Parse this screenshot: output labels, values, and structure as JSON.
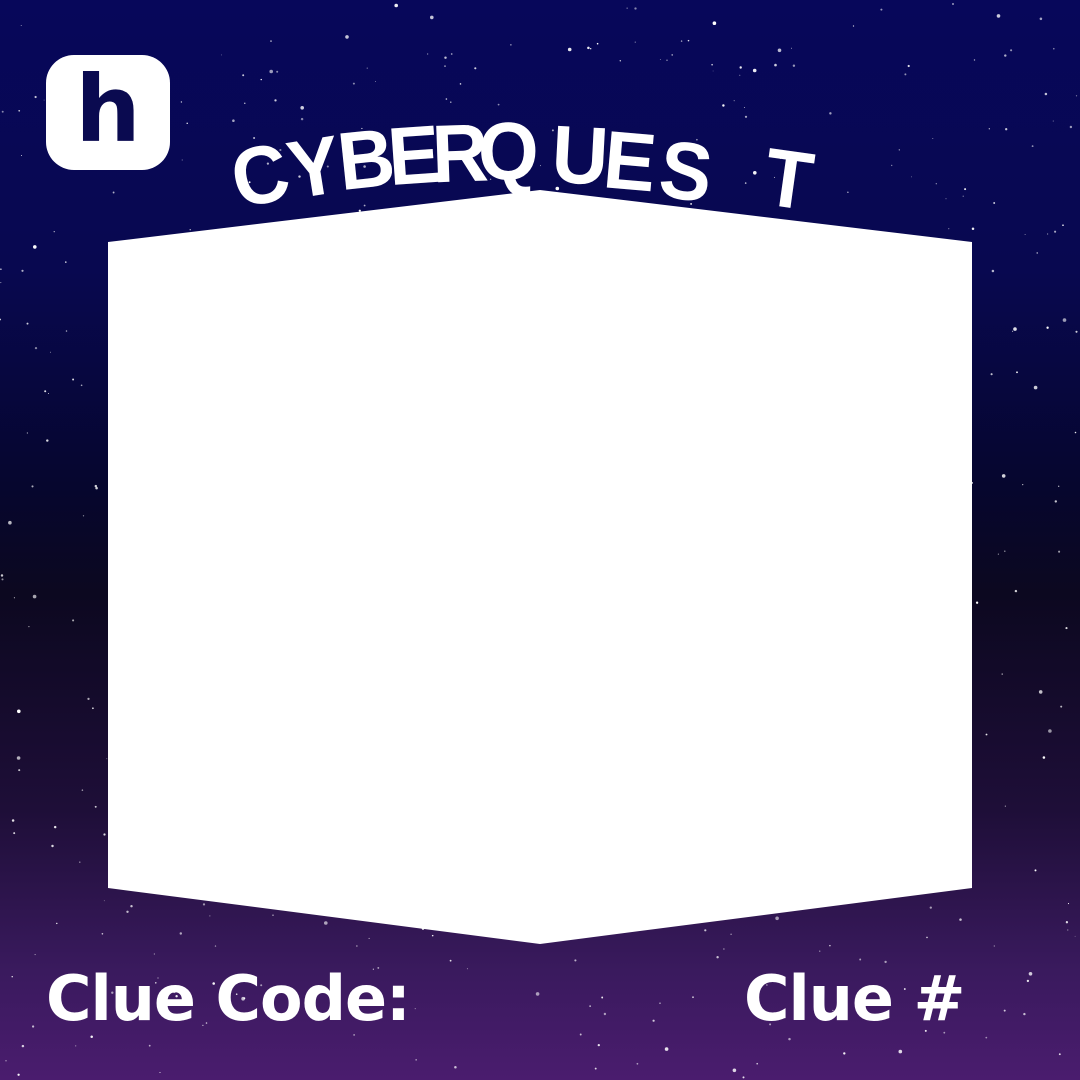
{
  "logo": {
    "letter": "h"
  },
  "title": "CYBERQUEST",
  "footer": {
    "clue_code_label": "Clue Code:",
    "clue_number_label": "Clue #"
  },
  "colors": {
    "frame": "#ffffff",
    "text": "#ffffff",
    "logo_letter": "#0a0a50"
  }
}
